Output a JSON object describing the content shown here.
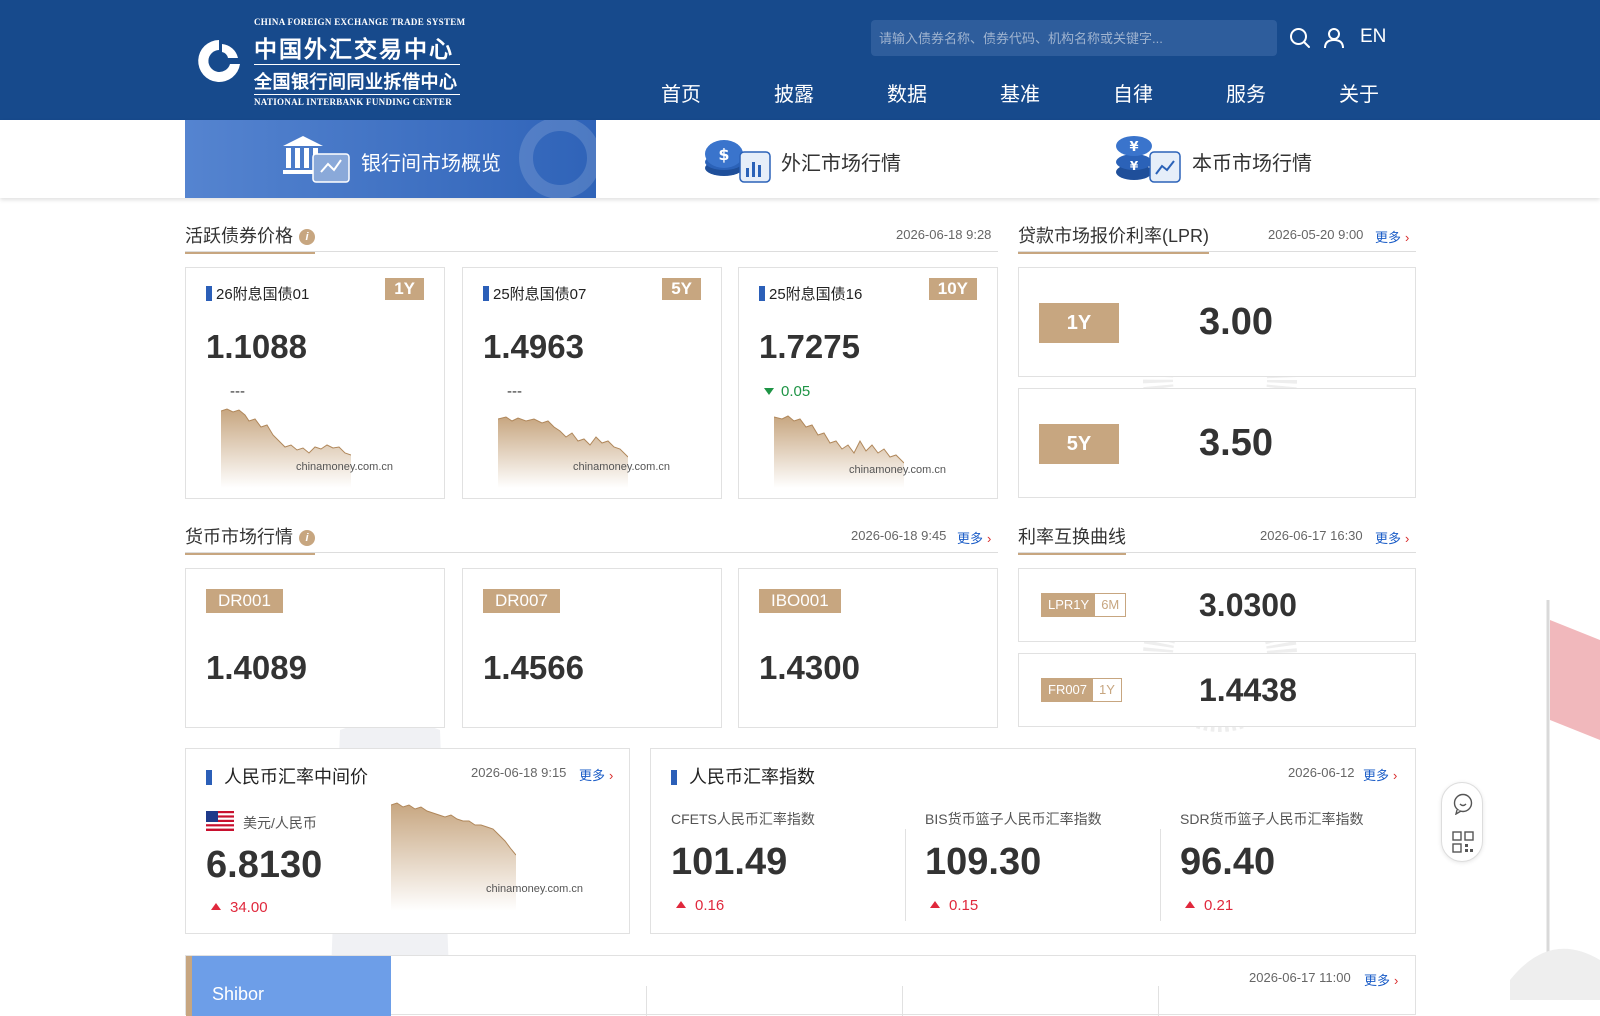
{
  "header": {
    "logo": {
      "en_top": "CHINA FOREIGN EXCHANGE TRADE SYSTEM",
      "cn_main": "中国外汇交易中心",
      "cn_sub": "全国银行间同业拆借中心",
      "en_bottom": "NATIONAL INTERBANK FUNDING CENTER"
    },
    "search_placeholder": "请输入债券名称、债券代码、机构名称或关键字...",
    "lang": "EN",
    "nav": [
      "首页",
      "披露",
      "数据",
      "基准",
      "自律",
      "服务",
      "关于"
    ]
  },
  "tabs": [
    {
      "label": "银行间市场概览",
      "active": true
    },
    {
      "label": "外汇市场行情",
      "active": false
    },
    {
      "label": "本币市场行情",
      "active": false
    }
  ],
  "active_bonds": {
    "title": "活跃债券价格",
    "info": "i",
    "date": "2026-06-18 9:28",
    "items": [
      {
        "name": "26附息国债01",
        "tenor": "1Y",
        "value": "1.1088",
        "change": "---",
        "direction": "none",
        "watermark": "chinamoney.com.cn"
      },
      {
        "name": "25附息国债07",
        "tenor": "5Y",
        "value": "1.4963",
        "change": "---",
        "direction": "none",
        "watermark": "chinamoney.com.cn"
      },
      {
        "name": "25附息国债16",
        "tenor": "10Y",
        "value": "1.7275",
        "change": "0.05",
        "direction": "down",
        "watermark": "chinamoney.com.cn"
      }
    ]
  },
  "lpr": {
    "title": "贷款市场报价利率(LPR)",
    "date": "2026-05-20 9:00",
    "more": "更多",
    "items": [
      {
        "tenor": "1Y",
        "value": "3.00"
      },
      {
        "tenor": "5Y",
        "value": "3.50"
      }
    ]
  },
  "money_market": {
    "title": "货币市场行情",
    "info": "i",
    "date": "2026-06-18 9:45",
    "more": "更多",
    "items": [
      {
        "code": "DR001",
        "value": "1.4089"
      },
      {
        "code": "DR007",
        "value": "1.4566"
      },
      {
        "code": "IBO001",
        "value": "1.4300"
      }
    ]
  },
  "swap": {
    "title": "利率互换曲线",
    "date": "2026-06-17 16:30",
    "more": "更多",
    "items": [
      {
        "curve": "LPR1Y",
        "tenor": "6M",
        "value": "3.0300"
      },
      {
        "curve": "FR007",
        "tenor": "1Y",
        "value": "1.4438"
      }
    ]
  },
  "rmb_central": {
    "title": "人民币汇率中间价",
    "date": "2026-06-18 9:15",
    "more": "更多",
    "pair": "美元/人民币",
    "value": "6.8130",
    "change": "34.00",
    "direction": "up",
    "watermark": "chinamoney.com.cn"
  },
  "rmb_index": {
    "title": "人民币汇率指数",
    "date": "2026-06-12",
    "more": "更多",
    "items": [
      {
        "label": "CFETS人民币汇率指数",
        "value": "101.49",
        "change": "0.16",
        "direction": "up"
      },
      {
        "label": "BIS货币篮子人民币汇率指数",
        "value": "109.30",
        "change": "0.15",
        "direction": "up"
      },
      {
        "label": "SDR货币篮子人民币汇率指数",
        "value": "96.40",
        "change": "0.21",
        "direction": "up"
      }
    ]
  },
  "shibor": {
    "tab_label": "Shibor",
    "date": "2026-06-17 11:00",
    "more": "更多"
  },
  "colors": {
    "header_bg": "#174a8c",
    "accent_gold": "#c7a680",
    "link_blue": "#1a5cc7",
    "up_red": "#e0283c",
    "down_green": "#1e9445"
  },
  "icons": [
    "search-icon",
    "user-icon",
    "bank-icon",
    "forex-coins-icon",
    "rmb-coins-icon",
    "info-icon",
    "chevron-right-icon",
    "us-flag-icon",
    "chat-icon",
    "qr-code-icon"
  ]
}
